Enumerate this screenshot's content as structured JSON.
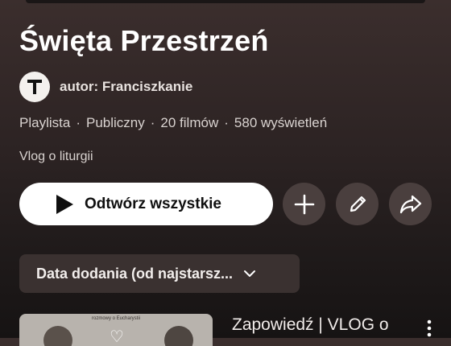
{
  "playlist": {
    "title": "Święta Przestrzeń",
    "author": "autor: Franciszkanie",
    "avatar_letter": "T",
    "meta": {
      "type": "Playlista",
      "visibility": "Publiczny",
      "videos": "20 filmów",
      "views": "580 wyświetleń"
    },
    "description": "Vlog o liturgii"
  },
  "actions": {
    "play_all": "Odtwórz wszystkie",
    "add_icon": "plus-icon",
    "edit_icon": "pencil-icon",
    "share_icon": "share-arrow-icon"
  },
  "sort": {
    "selected": "Data dodania (od najstarsz..."
  },
  "videos": [
    {
      "title": "Zapowiedź | VLOG o",
      "thumb_caption": "rozmowy o Eucharystii"
    }
  ],
  "colors": {
    "background_top": "#3b2e2d",
    "button_bg": "#4a3f3e",
    "sort_bg": "#3a3130"
  }
}
